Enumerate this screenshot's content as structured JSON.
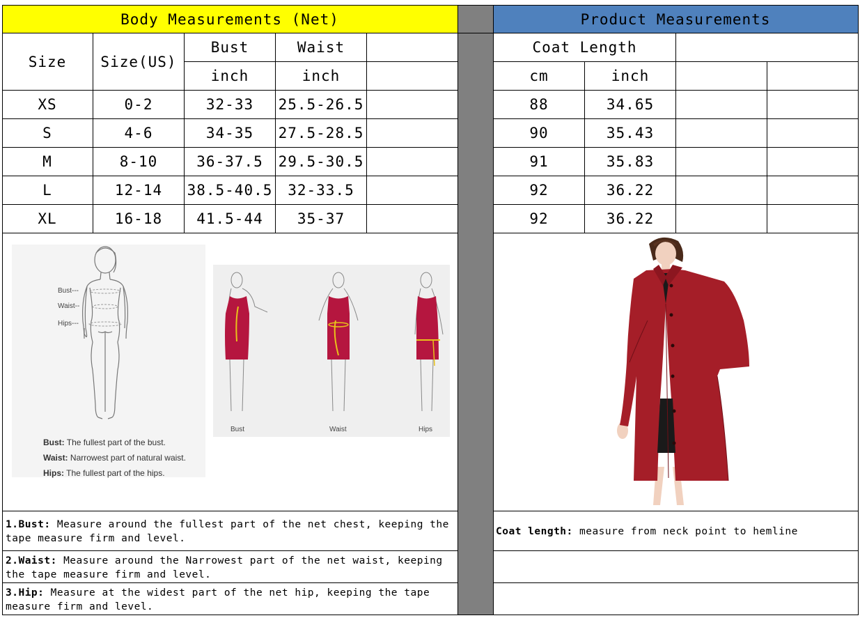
{
  "body_table": {
    "title": "Body Measurements (Net)",
    "col_size": "Size",
    "col_size_us": "Size(US)",
    "col_bust": "Bust",
    "col_waist": "Waist",
    "unit_bust": "inch",
    "unit_waist": "inch",
    "rows": [
      {
        "size": "XS",
        "us": "0-2",
        "bust": "32-33",
        "waist": "25.5-26.5"
      },
      {
        "size": "S",
        "us": "4-6",
        "bust": "34-35",
        "waist": "27.5-28.5"
      },
      {
        "size": "M",
        "us": "8-10",
        "bust": "36-37.5",
        "waist": "29.5-30.5"
      },
      {
        "size": "L",
        "us": "12-14",
        "bust": "38.5-40.5",
        "waist": "32-33.5"
      },
      {
        "size": "XL",
        "us": "16-18",
        "bust": "41.5-44",
        "waist": "35-37"
      }
    ]
  },
  "product_table": {
    "title": "Product Measurements",
    "col_coat_length": "Coat Length",
    "unit_cm": "cm",
    "unit_inch": "inch",
    "rows": [
      {
        "cm": "88",
        "inch": "34.65"
      },
      {
        "cm": "90",
        "inch": "35.43"
      },
      {
        "cm": "91",
        "inch": "35.83"
      },
      {
        "cm": "92",
        "inch": "36.22"
      },
      {
        "cm": "92",
        "inch": "36.22"
      }
    ]
  },
  "diagram": {
    "bust_marker": "Bust---",
    "waist_marker": "Waist--",
    "hips_marker": "Hips---",
    "bust_term": "Bust:",
    "bust_def": "The fullest part of the bust.",
    "waist_term": "Waist:",
    "waist_def": "Narrowest part of natural waist.",
    "hips_term": "Hips:",
    "hips_def": "The fullest part of the hips.",
    "fig_bust": "Bust",
    "fig_waist": "Waist",
    "fig_hips": "Hips"
  },
  "notes": {
    "bust_label": "1.Bust:",
    "bust_text_1": " Measure around the fullest part of the net chest, keeping the",
    "bust_text_2": "tape  measure firm and level.",
    "waist_label": "2.Waist:",
    "waist_text_1": " Measure around the Narrowest part of the net waist, keeping",
    "waist_text_2": "the tape  measure firm and level.",
    "hip_label": "3.Hip:",
    "hip_text_1": " Measure at the widest part of the net hip, keeping the tape",
    "hip_text_2": "measure firm and level.",
    "coat_label": "Coat length:",
    "coat_text": " measure from neck point to hemline"
  },
  "colors": {
    "body_header_bg": "#ffff00",
    "product_header_bg": "#4f81bd",
    "divider_column": "#808080",
    "coat_red": "#a51e28",
    "dress_red": "#b5163f"
  }
}
